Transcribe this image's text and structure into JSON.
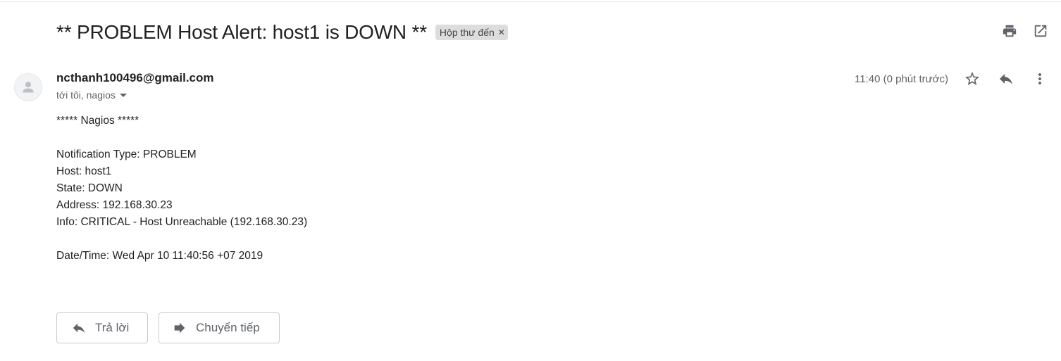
{
  "email": {
    "subject": "** PROBLEM Host Alert: host1 is DOWN **",
    "label": "Hộp thư đến",
    "sender": "ncthanh100496@gmail.com",
    "recipients": "tới tôi, nagios",
    "time": "11:40 (0 phút trước)",
    "body_lines": [
      "***** Nagios *****",
      "",
      "Notification Type: PROBLEM",
      "Host: host1",
      "State: DOWN",
      "Address: 192.168.30.23",
      "Info: CRITICAL - Host Unreachable (192.168.30.23)",
      "",
      "Date/Time: Wed Apr 10 11:40:56 +07 2019"
    ]
  },
  "actions": {
    "reply_label": "Trả lời",
    "forward_label": "Chuyển tiếp"
  },
  "icons": {
    "print": "print-icon",
    "open_new_window": "open-in-new-window-icon",
    "star": "star-icon",
    "reply": "reply-icon",
    "more": "more-vertical-icon",
    "forward": "forward-icon",
    "label_remove": "close-icon",
    "avatar": "person-icon"
  }
}
